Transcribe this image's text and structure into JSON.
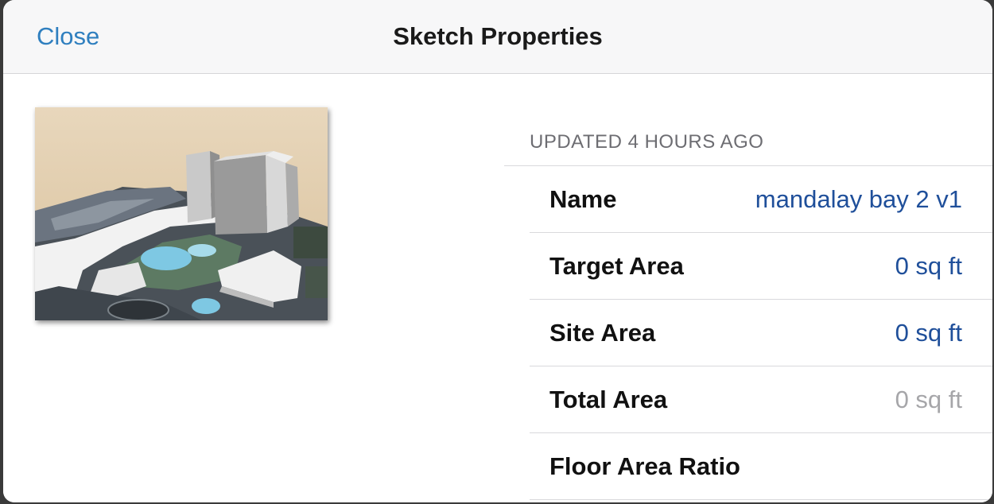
{
  "navbar": {
    "close_label": "Close",
    "title": "Sketch Properties"
  },
  "thumbnail": {
    "icon": "sketch-3d-model-preview"
  },
  "properties": {
    "section_header": "UPDATED 4 HOURS AGO",
    "rows": [
      {
        "label": "Name",
        "value": "mandalay bay 2 v1",
        "editable": true
      },
      {
        "label": "Target Area",
        "value": "0 sq ft",
        "editable": true
      },
      {
        "label": "Site Area",
        "value": "0 sq ft",
        "editable": true
      },
      {
        "label": "Total Area",
        "value": "0 sq ft",
        "editable": false
      },
      {
        "label": "Floor Area Ratio",
        "value": "",
        "editable": false
      }
    ]
  },
  "colors": {
    "accent": "#2f7fbf",
    "value_text": "#1f4f9a",
    "disabled_text": "#a6a6a9"
  }
}
